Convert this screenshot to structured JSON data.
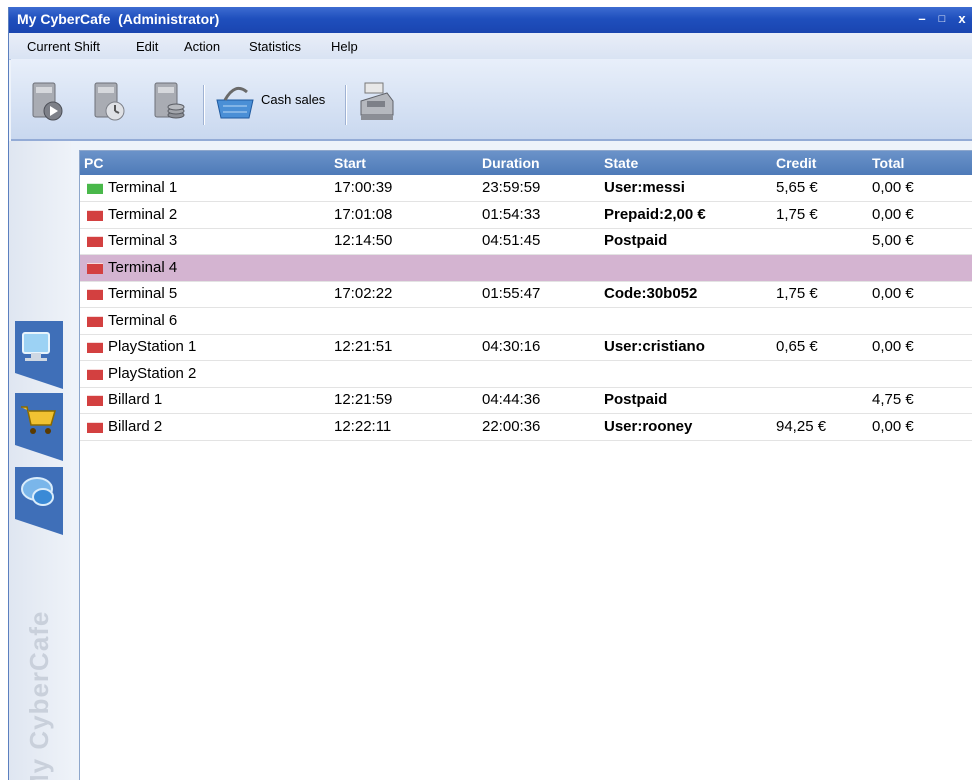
{
  "window": {
    "title": "My CyberCafe  (Administrator)",
    "minimize_label": "–",
    "maximize_label": "□",
    "close_label": "x"
  },
  "menu": [
    "Current Shift",
    "Edit",
    "Action",
    "Statistics",
    "Help"
  ],
  "toolbar": {
    "cash_label": "Cash sales",
    "icons": [
      "start-session-icon",
      "stop-session-icon",
      "cash-register-coins-icon",
      "basket-icon",
      "cash-register-icon"
    ]
  },
  "sidebar": {
    "brand": "My CyberCafe",
    "tabs": [
      "monitor-icon",
      "shopping-cart-icon",
      "chat-icon"
    ]
  },
  "colors": {
    "status_green": "#49b84a",
    "status_red": "#d34040",
    "selected_row": "#d4b4d1",
    "header_blue": "#5a84bf"
  },
  "table": {
    "headers": [
      "PC",
      "Start",
      "Duration",
      "State",
      "Credit",
      "Total"
    ],
    "rows": [
      {
        "pc": "Terminal 1",
        "status": "green",
        "start": "17:00:39",
        "duration": "23:59:59",
        "state": "User:messi",
        "credit": "5,65 €",
        "total": "0,00 €",
        "selected": false
      },
      {
        "pc": "Terminal 2",
        "status": "red",
        "start": "17:01:08",
        "duration": "01:54:33",
        "state": "Prepaid:2,00 €",
        "credit": "1,75 €",
        "total": "0,00 €",
        "selected": false
      },
      {
        "pc": "Terminal 3",
        "status": "red",
        "start": "12:14:50",
        "duration": "04:51:45",
        "state": "Postpaid",
        "credit": "",
        "total": "5,00 €",
        "selected": false
      },
      {
        "pc": "Terminal 4",
        "status": "red",
        "start": "",
        "duration": "",
        "state": "",
        "credit": "",
        "total": "",
        "selected": true
      },
      {
        "pc": "Terminal 5",
        "status": "red",
        "start": "17:02:22",
        "duration": "01:55:47",
        "state": "Code:30b052",
        "credit": "1,75 €",
        "total": "0,00 €",
        "selected": false
      },
      {
        "pc": "Terminal 6",
        "status": "red",
        "start": "",
        "duration": "",
        "state": "",
        "credit": "",
        "total": "",
        "selected": false
      },
      {
        "pc": "PlayStation 1",
        "status": "red",
        "start": "12:21:51",
        "duration": "04:30:16",
        "state": "User:cristiano",
        "credit": "0,65 €",
        "total": "0,00 €",
        "selected": false
      },
      {
        "pc": "PlayStation 2",
        "status": "red",
        "start": "",
        "duration": "",
        "state": "",
        "credit": "",
        "total": "",
        "selected": false
      },
      {
        "pc": "Billard 1",
        "status": "red",
        "start": "12:21:59",
        "duration": "04:44:36",
        "state": "Postpaid",
        "credit": "",
        "total": "4,75 €",
        "selected": false
      },
      {
        "pc": "Billard 2",
        "status": "red",
        "start": "12:22:11",
        "duration": "22:00:36",
        "state": "User:rooney",
        "credit": "94,25 €",
        "total": "0,00 €",
        "selected": false
      }
    ]
  }
}
